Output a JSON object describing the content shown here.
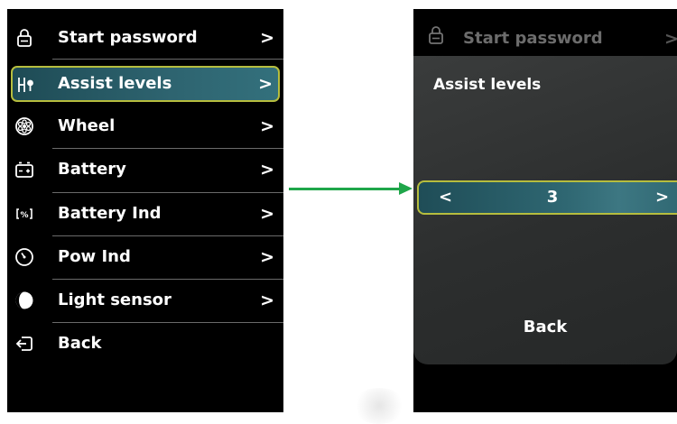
{
  "left_menu": {
    "items": [
      {
        "label": "Start password",
        "icon": "lock-icon",
        "chevron": ">"
      },
      {
        "label": "Assist levels",
        "icon": "assist-levels-icon",
        "chevron": ">"
      },
      {
        "label": "Wheel",
        "icon": "wheel-icon",
        "chevron": ">"
      },
      {
        "label": "Battery",
        "icon": "battery-icon",
        "chevron": ">"
      },
      {
        "label": "Battery Ind",
        "icon": "battery-indicator-icon",
        "chevron": ">"
      },
      {
        "label": "Pow Ind",
        "icon": "power-indicator-icon",
        "chevron": ">"
      },
      {
        "label": "Light sensor",
        "icon": "light-sensor-icon",
        "chevron": ">"
      },
      {
        "label": "Back",
        "icon": "back-icon"
      }
    ],
    "selected_index": 1
  },
  "right_screen": {
    "header_label": "Start password",
    "header_chevron": ">",
    "panel_title": "Assist levels",
    "selector": {
      "left": "<",
      "value": "3",
      "right": ">"
    },
    "back_label": "Back"
  },
  "colors": {
    "highlight_border": "#b6bd3e",
    "highlight_fill": "#2e6470",
    "arrow": "#1fa64a",
    "screen_bg": "#000000"
  }
}
